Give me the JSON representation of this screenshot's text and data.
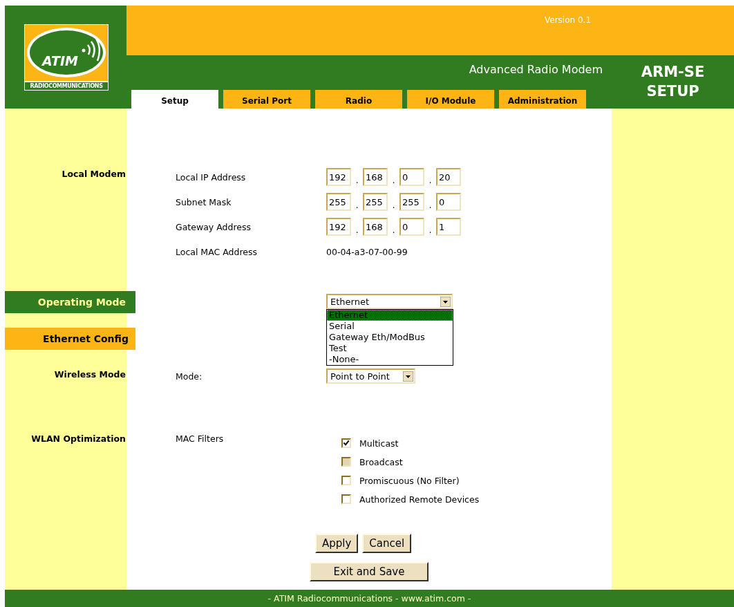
{
  "header": {
    "logo": {
      "name": "ATIM",
      "tagline": "RADIOCOMMUNICATIONS"
    },
    "version": "Version 0.1",
    "subtitle": "Advanced Radio Modem",
    "page_title": "ARM-SE SETUP"
  },
  "tabs": [
    {
      "label": "Setup",
      "selected": true
    },
    {
      "label": "Serial Port",
      "selected": false
    },
    {
      "label": "Radio",
      "selected": false
    },
    {
      "label": "I/O Module",
      "selected": false
    },
    {
      "label": "Administration",
      "selected": false
    }
  ],
  "local_modem": {
    "title": "Local Modem",
    "kind": "plain",
    "separator": ".",
    "rows": [
      {
        "label": "Local IP Address",
        "kind": "ip",
        "octets": [
          "192",
          "168",
          "0",
          "20"
        ]
      },
      {
        "label": "Subnet Mask",
        "kind": "ip",
        "octets": [
          "255",
          "255",
          "255",
          "0"
        ]
      },
      {
        "label": "Gateway Address",
        "kind": "ip",
        "octets": [
          "192",
          "168",
          "0",
          "1"
        ]
      },
      {
        "label": "Local MAC Address",
        "kind": "text",
        "value": "00-04-a3-07-00-99"
      }
    ]
  },
  "operating_mode": {
    "title": "Operating Mode",
    "kind": "current",
    "value": "Ethernet",
    "expanded": true,
    "options": [
      {
        "label": "Ethernet",
        "selected": true
      },
      {
        "label": "Serial",
        "selected": false
      },
      {
        "label": "Gateway Eth/ModBus",
        "selected": false
      },
      {
        "label": "Test",
        "selected": false
      },
      {
        "label": "-None-",
        "selected": false
      }
    ]
  },
  "ethernet_config": {
    "title": "Ethernet Config",
    "kind": "sub"
  },
  "wireless_mode": {
    "title": "Wireless Mode",
    "kind": "plain",
    "label": "Mode:",
    "value": "Point to Point"
  },
  "wlan_optimization": {
    "title": "WLAN Optimization",
    "kind": "plain",
    "label": "MAC Filters",
    "filters": [
      {
        "label": "Multicast",
        "checked": true,
        "disabled": false
      },
      {
        "label": "Broadcast",
        "checked": false,
        "disabled": true
      },
      {
        "label": "Promiscuous (No Filter)",
        "checked": false,
        "disabled": false
      },
      {
        "label": "Authorized Remote Devices",
        "checked": false,
        "disabled": false
      }
    ]
  },
  "buttons": [
    "Apply",
    "Cancel"
  ],
  "exit_button": "Exit and Save",
  "footer": "- ATIM Radiocommunications - www.atim.com -"
}
